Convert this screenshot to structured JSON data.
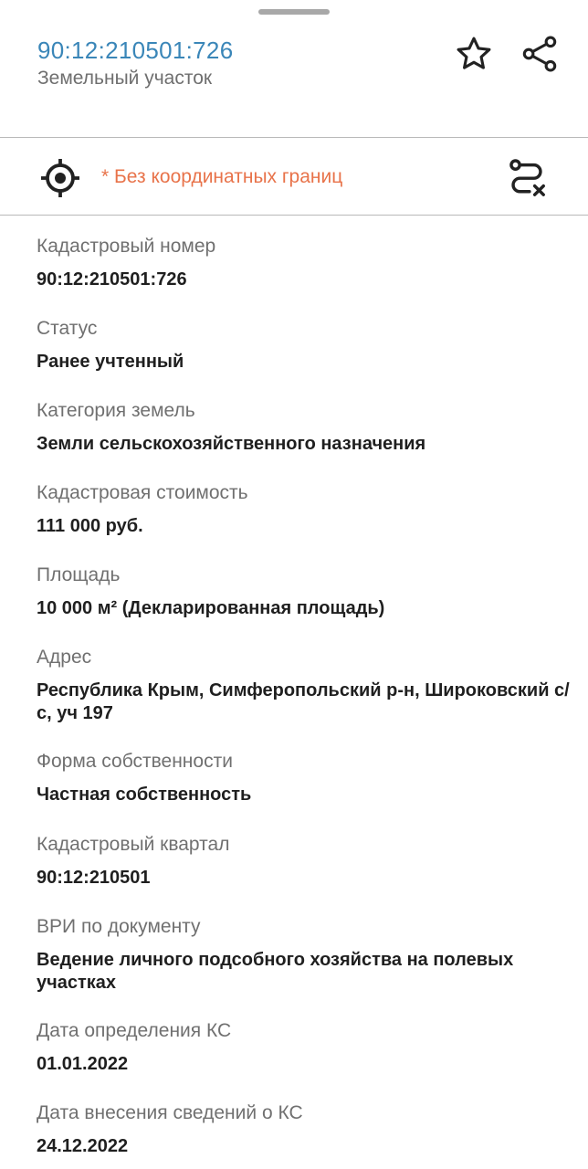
{
  "header": {
    "cadastral_id": "90:12:210501:726",
    "object_type": "Земельный участок",
    "icons": {
      "favorite": "star-icon",
      "share": "share-icon"
    }
  },
  "coords_bar": {
    "warning": "* Без координатных границ",
    "icons": {
      "locate": "crosshair-icon",
      "route": "route-cancel-icon"
    }
  },
  "colors": {
    "accent": "#3a86b8",
    "warning": "#e8734a",
    "label": "#707070",
    "value": "#1f1f1f"
  },
  "fields": [
    {
      "label": "Кадастровый номер",
      "value": "90:12:210501:726"
    },
    {
      "label": "Статус",
      "value": "Ранее учтенный"
    },
    {
      "label": "Категория земель",
      "value": "Земли сельскохозяйственного назначения"
    },
    {
      "label": "Кадастровая стоимость",
      "value": "111 000 руб."
    },
    {
      "label": "Площадь",
      "value": "10 000 м² (Декларированная площадь)"
    },
    {
      "label": "Адрес",
      "value": "Республика Крым, Симферопольский р-н, Широковский с/с, уч 197"
    },
    {
      "label": "Форма собственности",
      "value": "Частная собственность"
    },
    {
      "label": "Кадастровый квартал",
      "value": "90:12:210501"
    },
    {
      "label": "ВРИ по документу",
      "value": "Ведение личного подсобного хозяйства на полевых участках"
    },
    {
      "label": "Дата определения КС",
      "value": "01.01.2022"
    },
    {
      "label": "Дата внесения сведений о КС",
      "value": "24.12.2022"
    }
  ]
}
